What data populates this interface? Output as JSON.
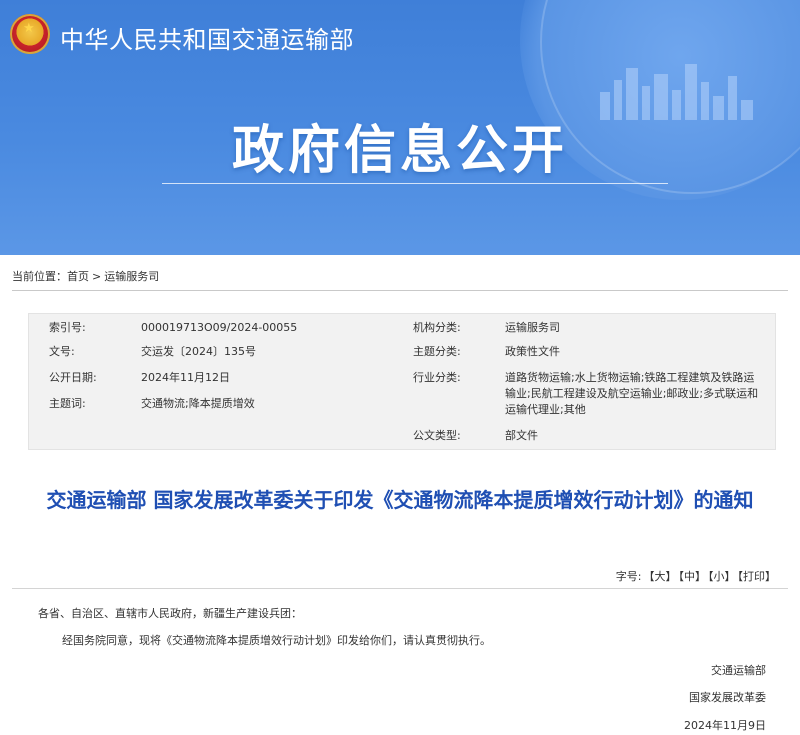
{
  "header": {
    "site_name": "中华人民共和国交通运输部",
    "page_heading": "政府信息公开"
  },
  "breadcrumb": {
    "label": "当前位置：",
    "home": "首页",
    "separator": ">",
    "section": "运输服务司"
  },
  "meta": {
    "index_label": "索引号:",
    "index_value": "000019713O09/2024-00055",
    "org_label": "机构分类:",
    "org_value": "运输服务司",
    "doc_no_label": "文号:",
    "doc_no_value": "交运发〔2024〕135号",
    "topic_label": "主题分类:",
    "topic_value": "政策性文件",
    "date_label": "公开日期:",
    "date_value": "2024年11月12日",
    "industry_label": "行业分类:",
    "industry_value": "道路货物运输;水上货物运输;铁路工程建筑及铁路运输业;民航工程建设及航空运输业;邮政业;多式联运和运输代理业;其他",
    "keywords_label": "主题词:",
    "keywords_value": "交通物流;降本提质增效",
    "doc_type_label": "公文类型:",
    "doc_type_value": "部文件"
  },
  "article": {
    "title": "交通运输部 国家发展改革委关于印发《交通物流降本提质增效行动计划》的通知",
    "salutation": "各省、自治区、直辖市人民政府，新疆生产建设兵团：",
    "paragraph": "经国务院同意，现将《交通物流降本提质增效行动计划》印发给你们，请认真贯彻执行。",
    "signer1": "交通运输部",
    "signer2": "国家发展改革委",
    "sign_date": "2024年11月9日"
  },
  "font_controls": {
    "label": "字号:",
    "large": "【大】",
    "medium": "【中】",
    "small": "【小】",
    "print": "【打印】"
  },
  "colors": {
    "banner_blue": "#4a8ae0",
    "title_blue": "#1f4fb3",
    "meta_bg": "#f2f2f2"
  }
}
